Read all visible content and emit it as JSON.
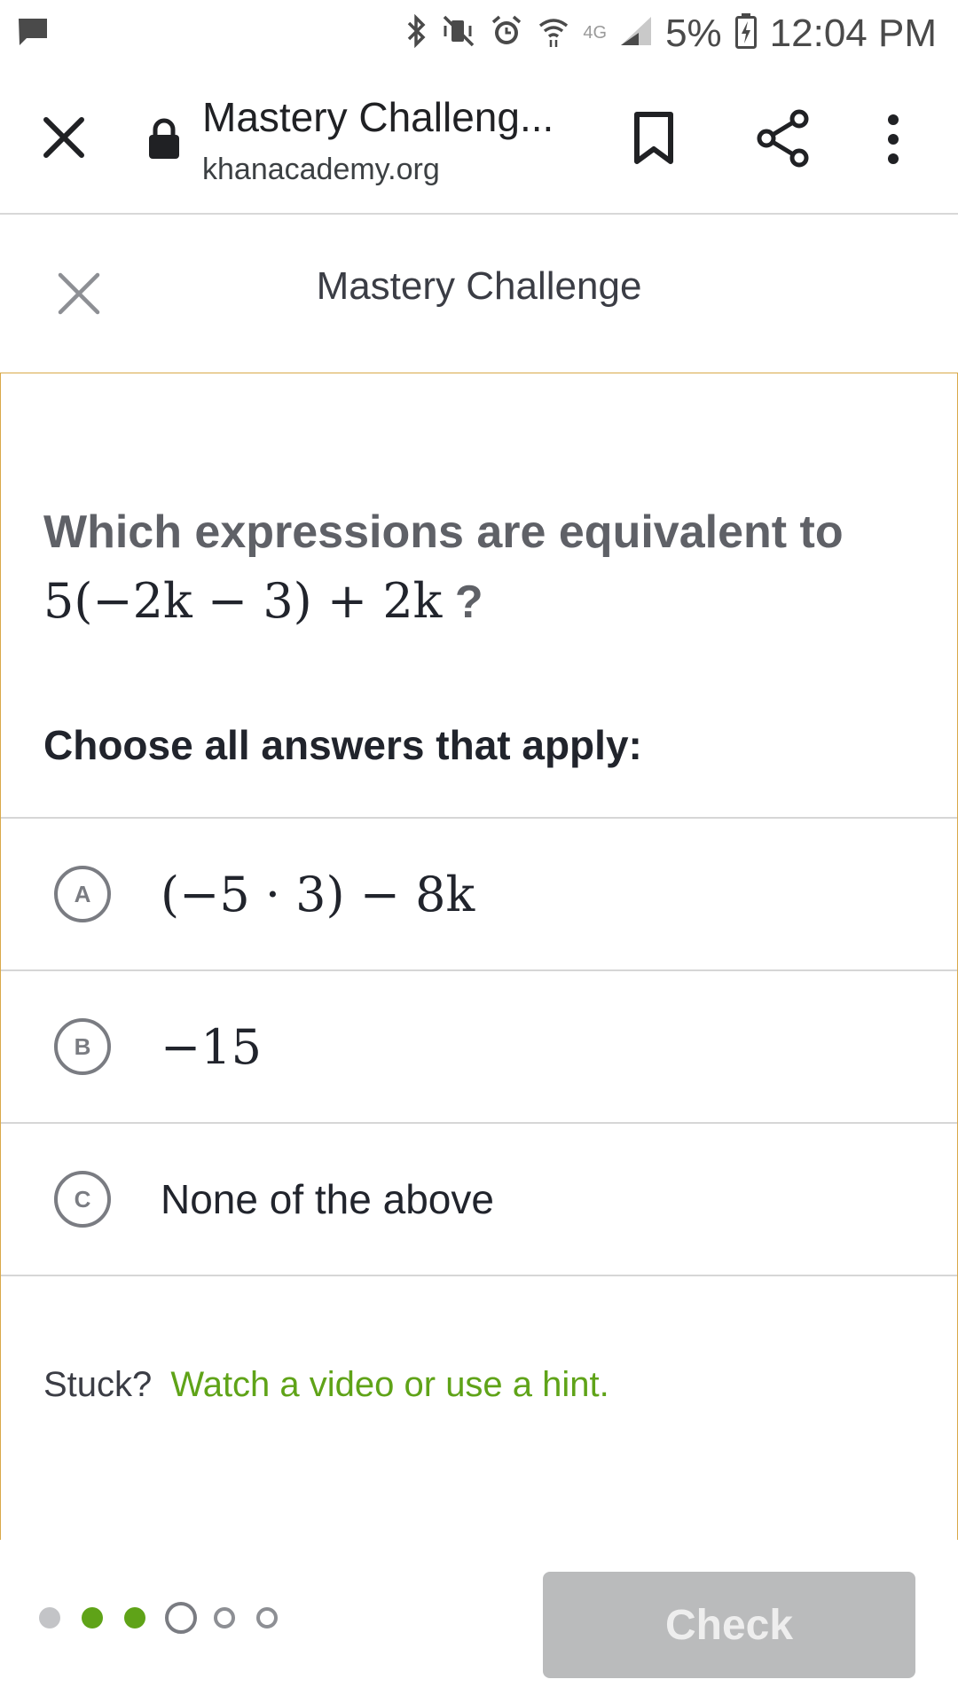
{
  "status_bar": {
    "battery": "5%",
    "time": "12:04 PM",
    "network": "4G",
    "icons": [
      "message-icon",
      "bluetooth-icon",
      "vibrate-mute-icon",
      "alarm-icon",
      "wifi-icon",
      "signal-icon",
      "battery-charging-icon"
    ]
  },
  "browser": {
    "title": "Mastery Challeng...",
    "url": "khanacademy.org"
  },
  "page": {
    "title": "Mastery Challenge"
  },
  "question": {
    "text": "Which expressions are equivalent to",
    "expression": "5(−2k − 3) + 2k",
    "suffix": " ?"
  },
  "instruction": "Choose all answers that apply:",
  "choices": [
    {
      "letter": "A",
      "text": "(−5 · 3) − 8k"
    },
    {
      "letter": "B",
      "text": "−15"
    },
    {
      "letter": "C",
      "text": "None of the above"
    }
  ],
  "stuck": {
    "label": "Stuck?",
    "link": "Watch a video or use a hint."
  },
  "progress": {
    "total": 6,
    "states": [
      "viewed",
      "correct",
      "correct",
      "current",
      "upcoming",
      "upcoming"
    ]
  },
  "footer": {
    "check_label": "Check"
  },
  "colors": {
    "accent_green": "#5fa318",
    "card_border": "#d9a94a",
    "check_disabled": "#babbbc"
  }
}
